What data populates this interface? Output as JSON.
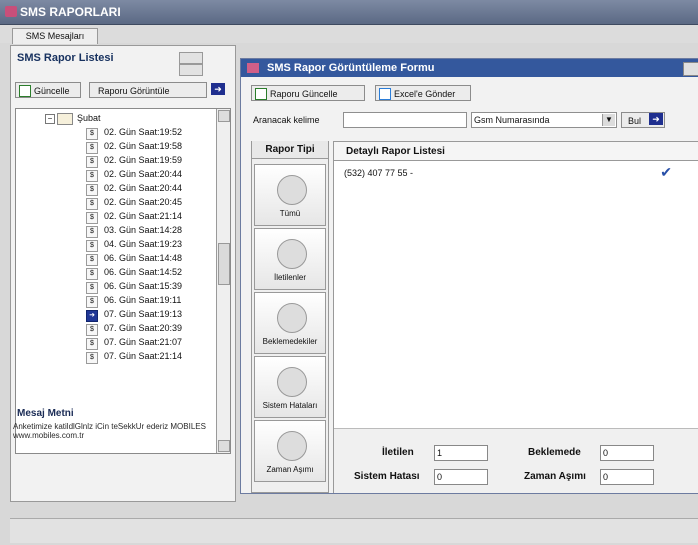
{
  "window_title": "SMS RAPORLARI",
  "tab_label": "SMS Mesajları",
  "left": {
    "title": "SMS Rapor Listesi",
    "buttons": [
      "Güncelle",
      "Raporu Görüntüle"
    ],
    "tree": {
      "month": "Şubat",
      "items": [
        "02. Gün Saat:19:52",
        "02. Gün Saat:19:58",
        "02. Gün Saat:19:59",
        "02. Gün Saat:20:44",
        "02. Gün Saat:20:44",
        "02. Gün Saat:20:45",
        "02. Gün Saat:21:14",
        "03. Gün Saat:14:28",
        "04. Gün Saat:19:23",
        "06. Gün Saat:14:48",
        "06. Gün Saat:14:52",
        "06. Gün Saat:15:39",
        "06. Gün Saat:19:11",
        "07. Gün Saat:19:13",
        "07. Gün Saat:20:39",
        "07. Gün Saat:21:07",
        "07. Gün Saat:21:14"
      ]
    },
    "message_title": "Mesaj Metni",
    "message_text": "Anketimize katildlGlnlz iCin teSekkUr ederiz MOBILES www.mobiles.com.tr"
  },
  "form": {
    "title": "SMS Rapor Görüntüleme Formu",
    "toolbar": {
      "update": "Raporu Güncelle",
      "excel": "Excel'e Gönder"
    },
    "search": {
      "label": "Aranacak kelime",
      "value": "",
      "field": "Gsm Numarasında",
      "find": "Bul"
    },
    "report_type_header": "Rapor Tipi",
    "detail_header": "Detaylı Rapor Listesi",
    "types": [
      "Tümü",
      "İletilenler",
      "Beklemedekiler",
      "Sistem Hataları",
      "Zaman Aşımı"
    ],
    "rows": [
      {
        "text": "(532) 407 77 55 -"
      }
    ],
    "stats": {
      "iletilen_label": "İletilen",
      "iletilen_value": "1",
      "beklemede_label": "Beklemede",
      "beklemede_value": "0",
      "sistem_hatasi_label": "Sistem Hatası",
      "sistem_hatasi_value": "0",
      "zaman_asimi_label": "Zaman Aşımı",
      "zaman_asimi_value": "0"
    }
  }
}
